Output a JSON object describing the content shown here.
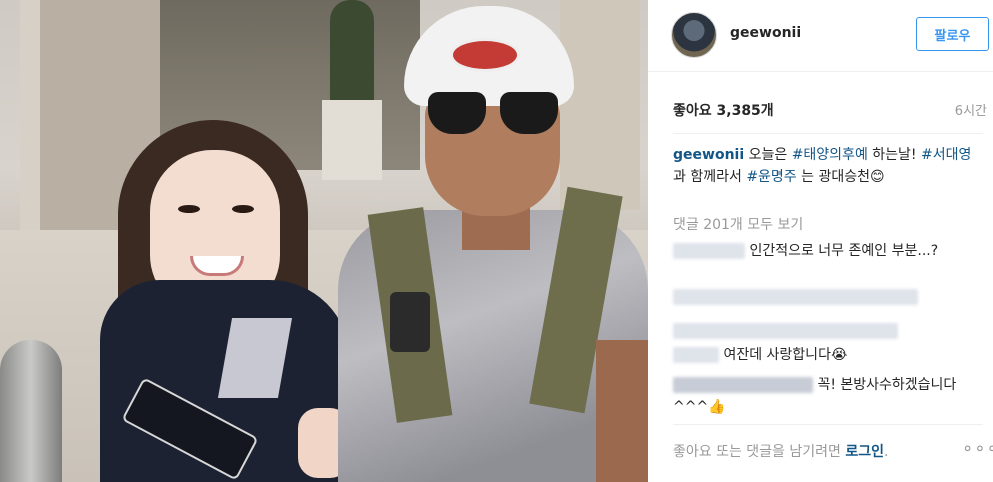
{
  "post": {
    "image_alt": "selfie-photo"
  },
  "header": {
    "username": "geewonii",
    "follow_label": "팔로우"
  },
  "stats": {
    "likes": "좋아요 3,385개",
    "time": "6시간"
  },
  "caption": {
    "username": "geewonii",
    "text1": " 오늘은 ",
    "tag1": "#태양의후예",
    "text2": " 하는날! ",
    "tag2": "#서대영",
    "text3": " 과 함께라서 ",
    "tag3": "#윤명주",
    "text4": " 는 광대승천😊"
  },
  "comments": {
    "view_all": "댓글 201개 모두 보기",
    "items": [
      {
        "text": "인간적으로 너무 존예인 부분...?"
      },
      {
        "text": ""
      },
      {
        "text": ""
      },
      {
        "text": "여잔데 사랑합니다😭"
      },
      {
        "text": "꼭! 본방사수하겠습니다^^^👍"
      }
    ]
  },
  "footer": {
    "prompt": "좋아요 또는 댓글을 남기려면 ",
    "login": "로그인",
    "end": ".",
    "more": "∘∘∘"
  }
}
